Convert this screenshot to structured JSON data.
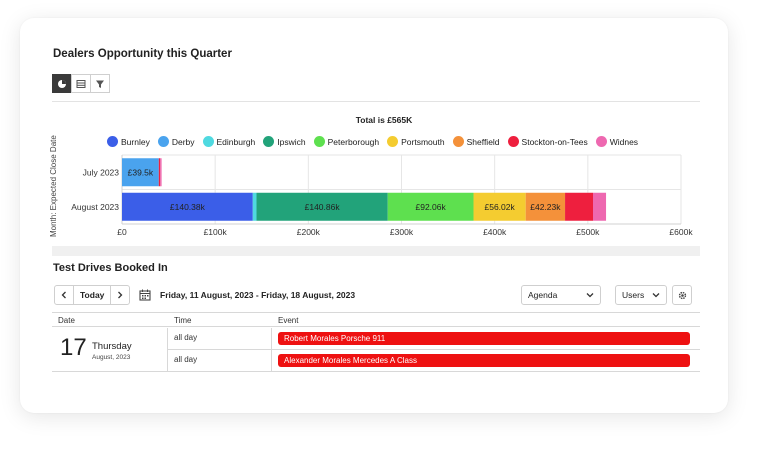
{
  "opportunity": {
    "title": "Dealers Opportunity this Quarter",
    "view_buttons": [
      "pie-chart-icon",
      "table-icon",
      "filter-icon"
    ]
  },
  "chart_data": {
    "type": "bar",
    "orientation": "horizontal",
    "stacked": true,
    "title": "Total is £565K",
    "ylabel": "Month: Expected Close Date",
    "xlabel": "",
    "categories": [
      "July 2023",
      "August 2023"
    ],
    "xlim": [
      0,
      600000
    ],
    "x_ticks": [
      "£0",
      "£100k",
      "£200k",
      "£300k",
      "£400k",
      "£500k",
      "£600k"
    ],
    "legend_position": "top",
    "grid": true,
    "series": [
      {
        "name": "Burnley",
        "color": "#3b5ee8",
        "values": [
          0,
          140380
        ],
        "labels": [
          "",
          "£140.38k"
        ]
      },
      {
        "name": "Derby",
        "color": "#4aa3ee",
        "values": [
          39500,
          0
        ],
        "labels": [
          "£39.5k",
          ""
        ]
      },
      {
        "name": "Edinburgh",
        "color": "#4fd9e0",
        "values": [
          0,
          4000
        ],
        "labels": [
          "",
          ""
        ]
      },
      {
        "name": "Ipswich",
        "color": "#22a37a",
        "values": [
          0,
          140860
        ],
        "labels": [
          "",
          "£140.86k"
        ]
      },
      {
        "name": "Peterborough",
        "color": "#5ee04f",
        "values": [
          0,
          92060
        ],
        "labels": [
          "",
          "£92.06k"
        ]
      },
      {
        "name": "Portsmouth",
        "color": "#f4cc30",
        "values": [
          0,
          56020
        ],
        "labels": [
          "",
          "£56.02k"
        ]
      },
      {
        "name": "Sheffield",
        "color": "#f4913a",
        "values": [
          0,
          42230
        ],
        "labels": [
          "",
          "£42.23k"
        ]
      },
      {
        "name": "Stockton-on-Tees",
        "color": "#ee1f3e",
        "values": [
          1500,
          30000
        ],
        "labels": [
          "",
          ""
        ]
      },
      {
        "name": "Widnes",
        "color": "#ee68b0",
        "values": [
          1500,
          14000
        ],
        "labels": [
          "",
          ""
        ]
      }
    ]
  },
  "testdrives": {
    "title": "Test Drives Booked In",
    "today_label": "Today",
    "prev_label": "‹",
    "next_label": "›",
    "date_range": "Friday, 11 August, 2023 - Friday, 18 August, 2023",
    "view_select": "Agenda",
    "group_select": "Users",
    "headers": {
      "date": "Date",
      "time": "Time",
      "event": "Event"
    },
    "day": {
      "number": "17",
      "name": "Thursday",
      "month": "August, 2023"
    },
    "rows": [
      {
        "time": "all day",
        "event": "Robert Morales Porsche 911",
        "color": "#ee1111"
      },
      {
        "time": "all day",
        "event": "Alexander Morales Mercedes A Class",
        "color": "#ee1111"
      }
    ]
  }
}
